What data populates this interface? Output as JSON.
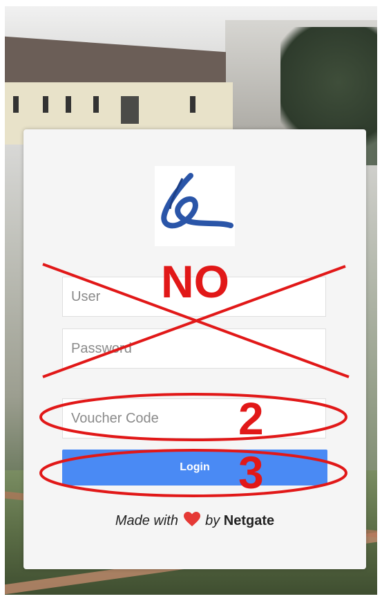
{
  "form": {
    "user_placeholder": "User",
    "password_placeholder": "Password",
    "voucher_placeholder": "Voucher Code",
    "login_label": "Login"
  },
  "footer": {
    "made_with": "Made with",
    "by": "by",
    "brand": "Netgate"
  },
  "annotations": {
    "no_label": "NO",
    "step2": "2",
    "step3": "3"
  },
  "colors": {
    "button": "#4a8af4",
    "annotation": "#e11818",
    "heart": "#e53935",
    "logo_blue": "#2a55a8"
  }
}
